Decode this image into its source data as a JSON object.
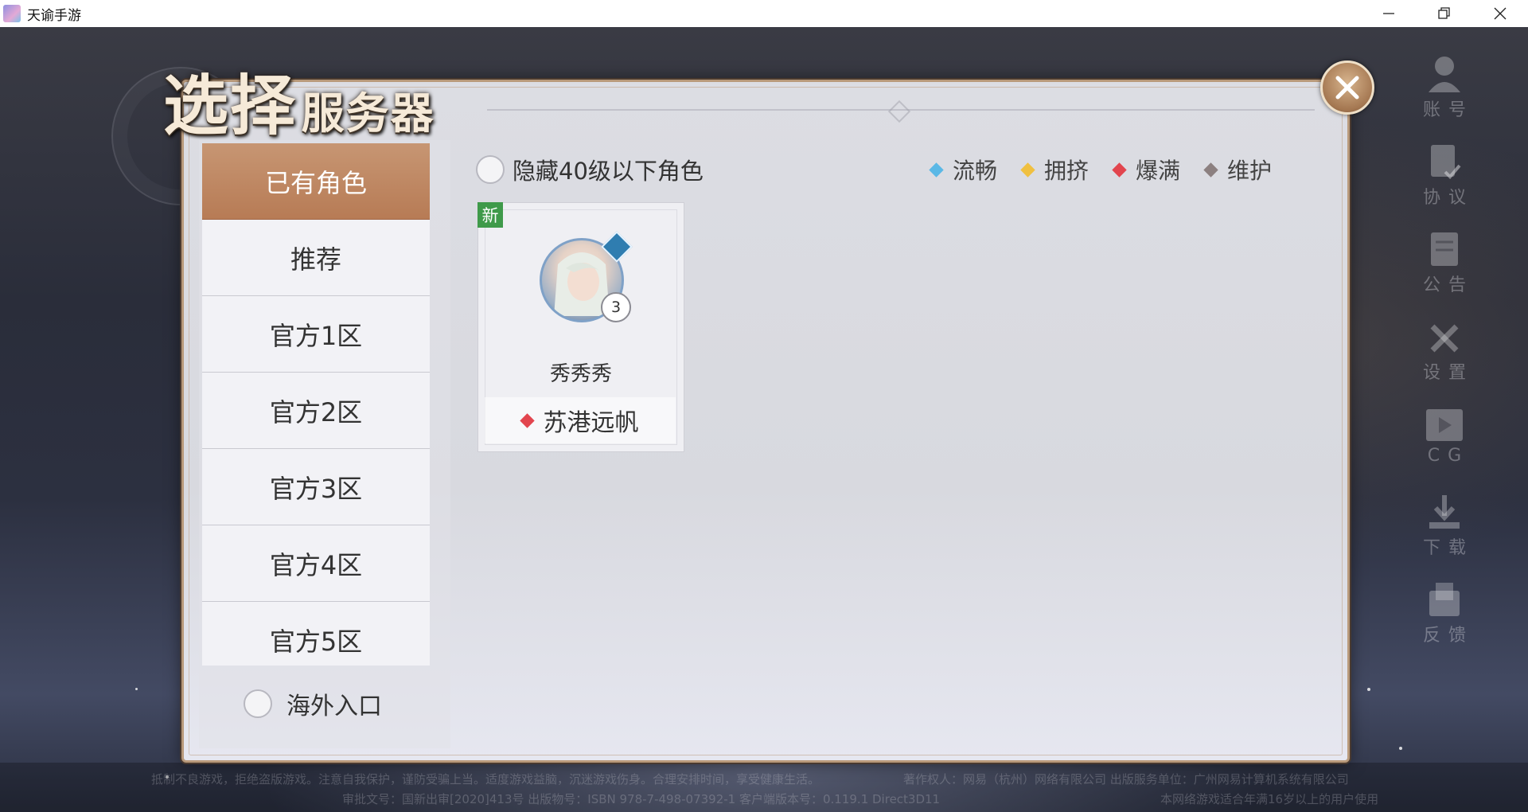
{
  "window": {
    "title": "天谕手游",
    "controls": {
      "minimize": "—",
      "restore": "❐",
      "close": "✕"
    }
  },
  "heading": {
    "main": "选择",
    "sub": "服务器"
  },
  "tabs": [
    {
      "label": "已有角色",
      "active": true
    },
    {
      "label": "推荐",
      "active": false
    },
    {
      "label": "官方1区",
      "active": false
    },
    {
      "label": "官方2区",
      "active": false
    },
    {
      "label": "官方3区",
      "active": false
    },
    {
      "label": "官方4区",
      "active": false
    },
    {
      "label": "官方5区",
      "active": false
    }
  ],
  "overseas": {
    "label": "海外入口",
    "checked": false
  },
  "hide_toggle": {
    "label": "隐藏40级以下角色",
    "checked": false
  },
  "legend": [
    {
      "label": "流畅",
      "color": "#5ab8e6"
    },
    {
      "label": "拥挤",
      "color": "#f0c040"
    },
    {
      "label": "爆满",
      "color": "#e2454e"
    },
    {
      "label": "维护",
      "color": "#8c8080"
    }
  ],
  "character_card": {
    "badge": "新",
    "level": "3",
    "name": "秀秀秀",
    "server": "苏港远帆",
    "server_status_color": "#e2454e"
  },
  "side_menu": [
    {
      "label": "账号",
      "icon": "account-icon"
    },
    {
      "label": "协议",
      "icon": "agreement-icon"
    },
    {
      "label": "公告",
      "icon": "announcement-icon"
    },
    {
      "label": "设置",
      "icon": "settings-icon"
    },
    {
      "label": "CG",
      "icon": "cg-play-icon"
    },
    {
      "label": "下载",
      "icon": "download-icon"
    },
    {
      "label": "反馈",
      "icon": "feedback-icon"
    }
  ],
  "footer": {
    "line1_left": "抵制不良游戏，拒绝盗版游戏。注意自我保护，谨防受骗上当。适度游戏益脑，沉迷游戏伤身。合理安排时间，享受健康生活。",
    "line1_right": "著作权人：网易（杭州）网络有限公司 出版服务单位：广州网易计算机系统有限公司",
    "line2_left": "审批文号：国新出审[2020]413号 出版物号：ISBN 978-7-498-07392-1 客户端版本号：0.119.1 Direct3D11",
    "line2_right": "本网络游戏适合年满16岁以上的用户使用"
  }
}
